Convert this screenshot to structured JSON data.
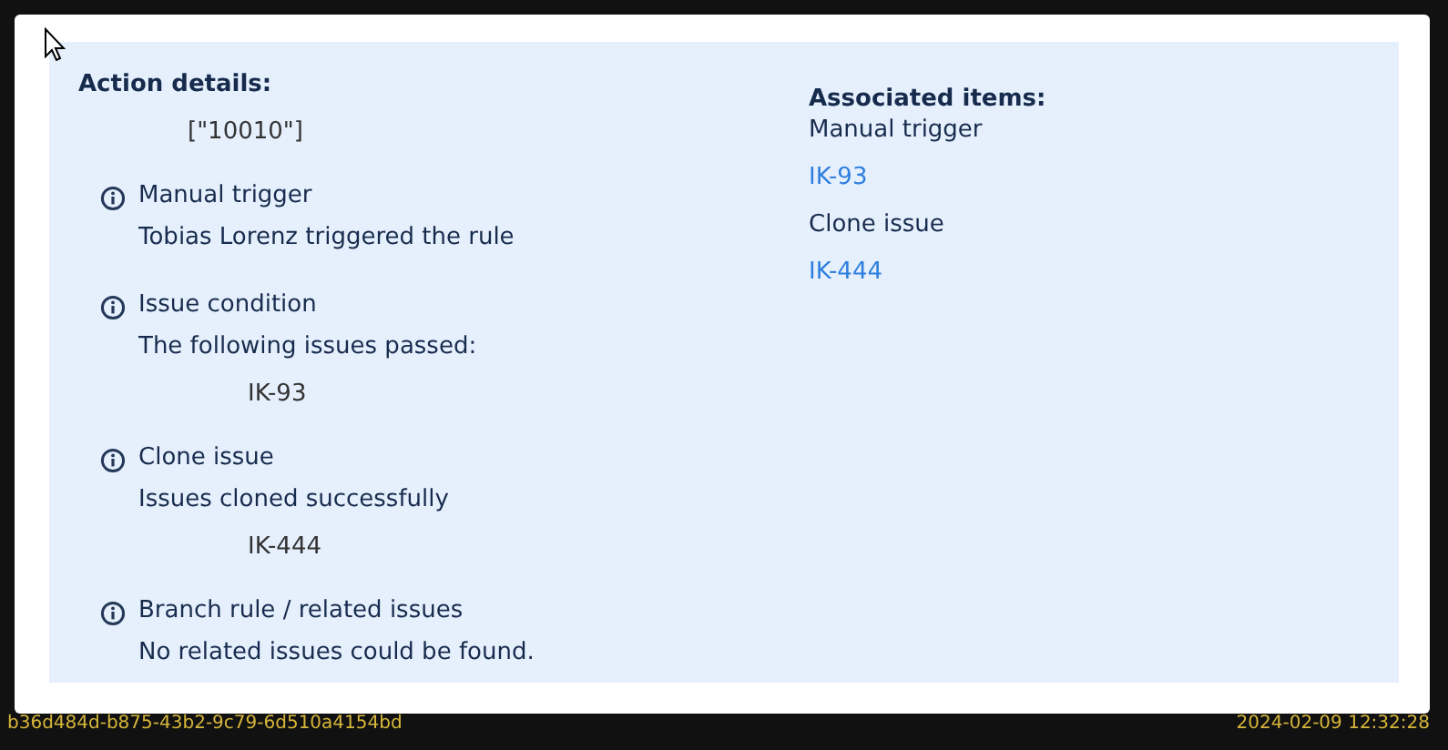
{
  "action_details": {
    "title": "Action details:",
    "value": "[\"10010\"]",
    "entries": [
      {
        "title": "Manual trigger",
        "message": "Tobias Lorenz triggered the rule"
      },
      {
        "title": "Issue condition",
        "message": "The following issues passed:",
        "issue": "IK-93"
      },
      {
        "title": "Clone issue",
        "message": "Issues cloned successfully",
        "issue": "IK-444"
      },
      {
        "title": "Branch rule / related issues",
        "message": "No related issues could be found."
      }
    ]
  },
  "associated_items": {
    "title": "Associated items:",
    "items": [
      {
        "kind": "text",
        "label": "Manual trigger"
      },
      {
        "kind": "link",
        "label": "IK-93"
      },
      {
        "kind": "text",
        "label": "Clone issue"
      },
      {
        "kind": "link",
        "label": "IK-444"
      }
    ]
  },
  "footer": {
    "id": "b36d484d-b875-43b2-9c79-6d510a4154bd",
    "timestamp": "2024-02-09 12:32:28"
  }
}
